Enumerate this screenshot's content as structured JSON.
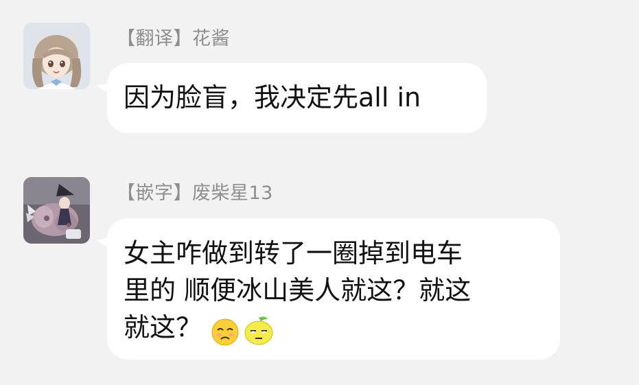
{
  "messages": [
    {
      "sender": "【翻译】花酱",
      "lines": [
        "因为脸盲，我决定先all in"
      ],
      "avatar_icon": "anime-girl-avatar-icon"
    },
    {
      "sender": "【嵌字】废柴星13",
      "lines": [
        "女主咋做到转了一圈掉到电车",
        "里的  顺便冰山美人就这？就这",
        "就这？"
      ],
      "emojis": [
        "sad-face-emoji-icon",
        "lemon-face-emoji-icon"
      ],
      "avatar_icon": "mecha-character-avatar-icon"
    }
  ]
}
